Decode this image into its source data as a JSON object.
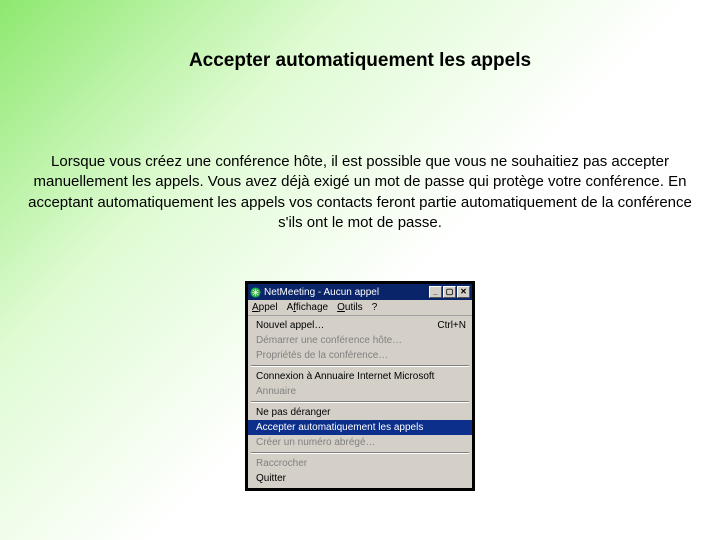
{
  "slide": {
    "title": "Accepter automatiquement les appels",
    "body": "Lorsque vous créez une conférence hôte, il est possible que vous ne souhaitiez pas accepter manuellement les appels. Vous avez déjà exigé un mot de passe qui protège votre conférence. En acceptant automatiquement les appels vos contacts feront partie automatiquement de la conférence s'ils ont le mot de passe."
  },
  "window": {
    "title": "NetMeeting - Aucun appel",
    "min_glyph": "_",
    "max_glyph": "▢",
    "close_glyph": "✕"
  },
  "menubar": {
    "appel": "Appel",
    "affichage": "Affichage",
    "outils": "Outils",
    "aide": "?"
  },
  "menu": {
    "nouvel_appel": "Nouvel appel…",
    "nouvel_appel_shortcut": "Ctrl+N",
    "demarrer": "Démarrer une conférence hôte…",
    "proprietes": "Propriétés de la conférence…",
    "connexion": "Connexion à Annuaire Internet Microsoft",
    "annuaire": "Annuaire",
    "ne_pas_deranger": "Ne pas déranger",
    "accepter_auto": "Accepter automatiquement les appels",
    "creer_numero": "Créer un numéro abrégé…",
    "raccrocher": "Raccrocher",
    "quitter": "Quitter"
  }
}
